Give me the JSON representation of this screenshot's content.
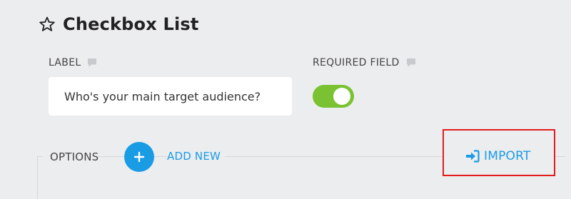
{
  "header": {
    "title": "Checkbox List",
    "icon": "star-outline-icon"
  },
  "label_field": {
    "label": "LABEL",
    "value": "Who's your main target audience?",
    "comment_icon": "comment-icon"
  },
  "required_field": {
    "label": "REQUIRED FIELD",
    "enabled": true,
    "toggle_color": "#7ac231",
    "comment_icon": "comment-icon"
  },
  "options": {
    "title": "OPTIONS",
    "add_new_label": "ADD NEW",
    "add_icon": "plus-icon",
    "import_label": "IMPORT",
    "import_icon": "sign-in-icon"
  },
  "colors": {
    "accent": "#1a9ce5",
    "highlight_box": "#e01d1d",
    "background": "#ecedef"
  }
}
